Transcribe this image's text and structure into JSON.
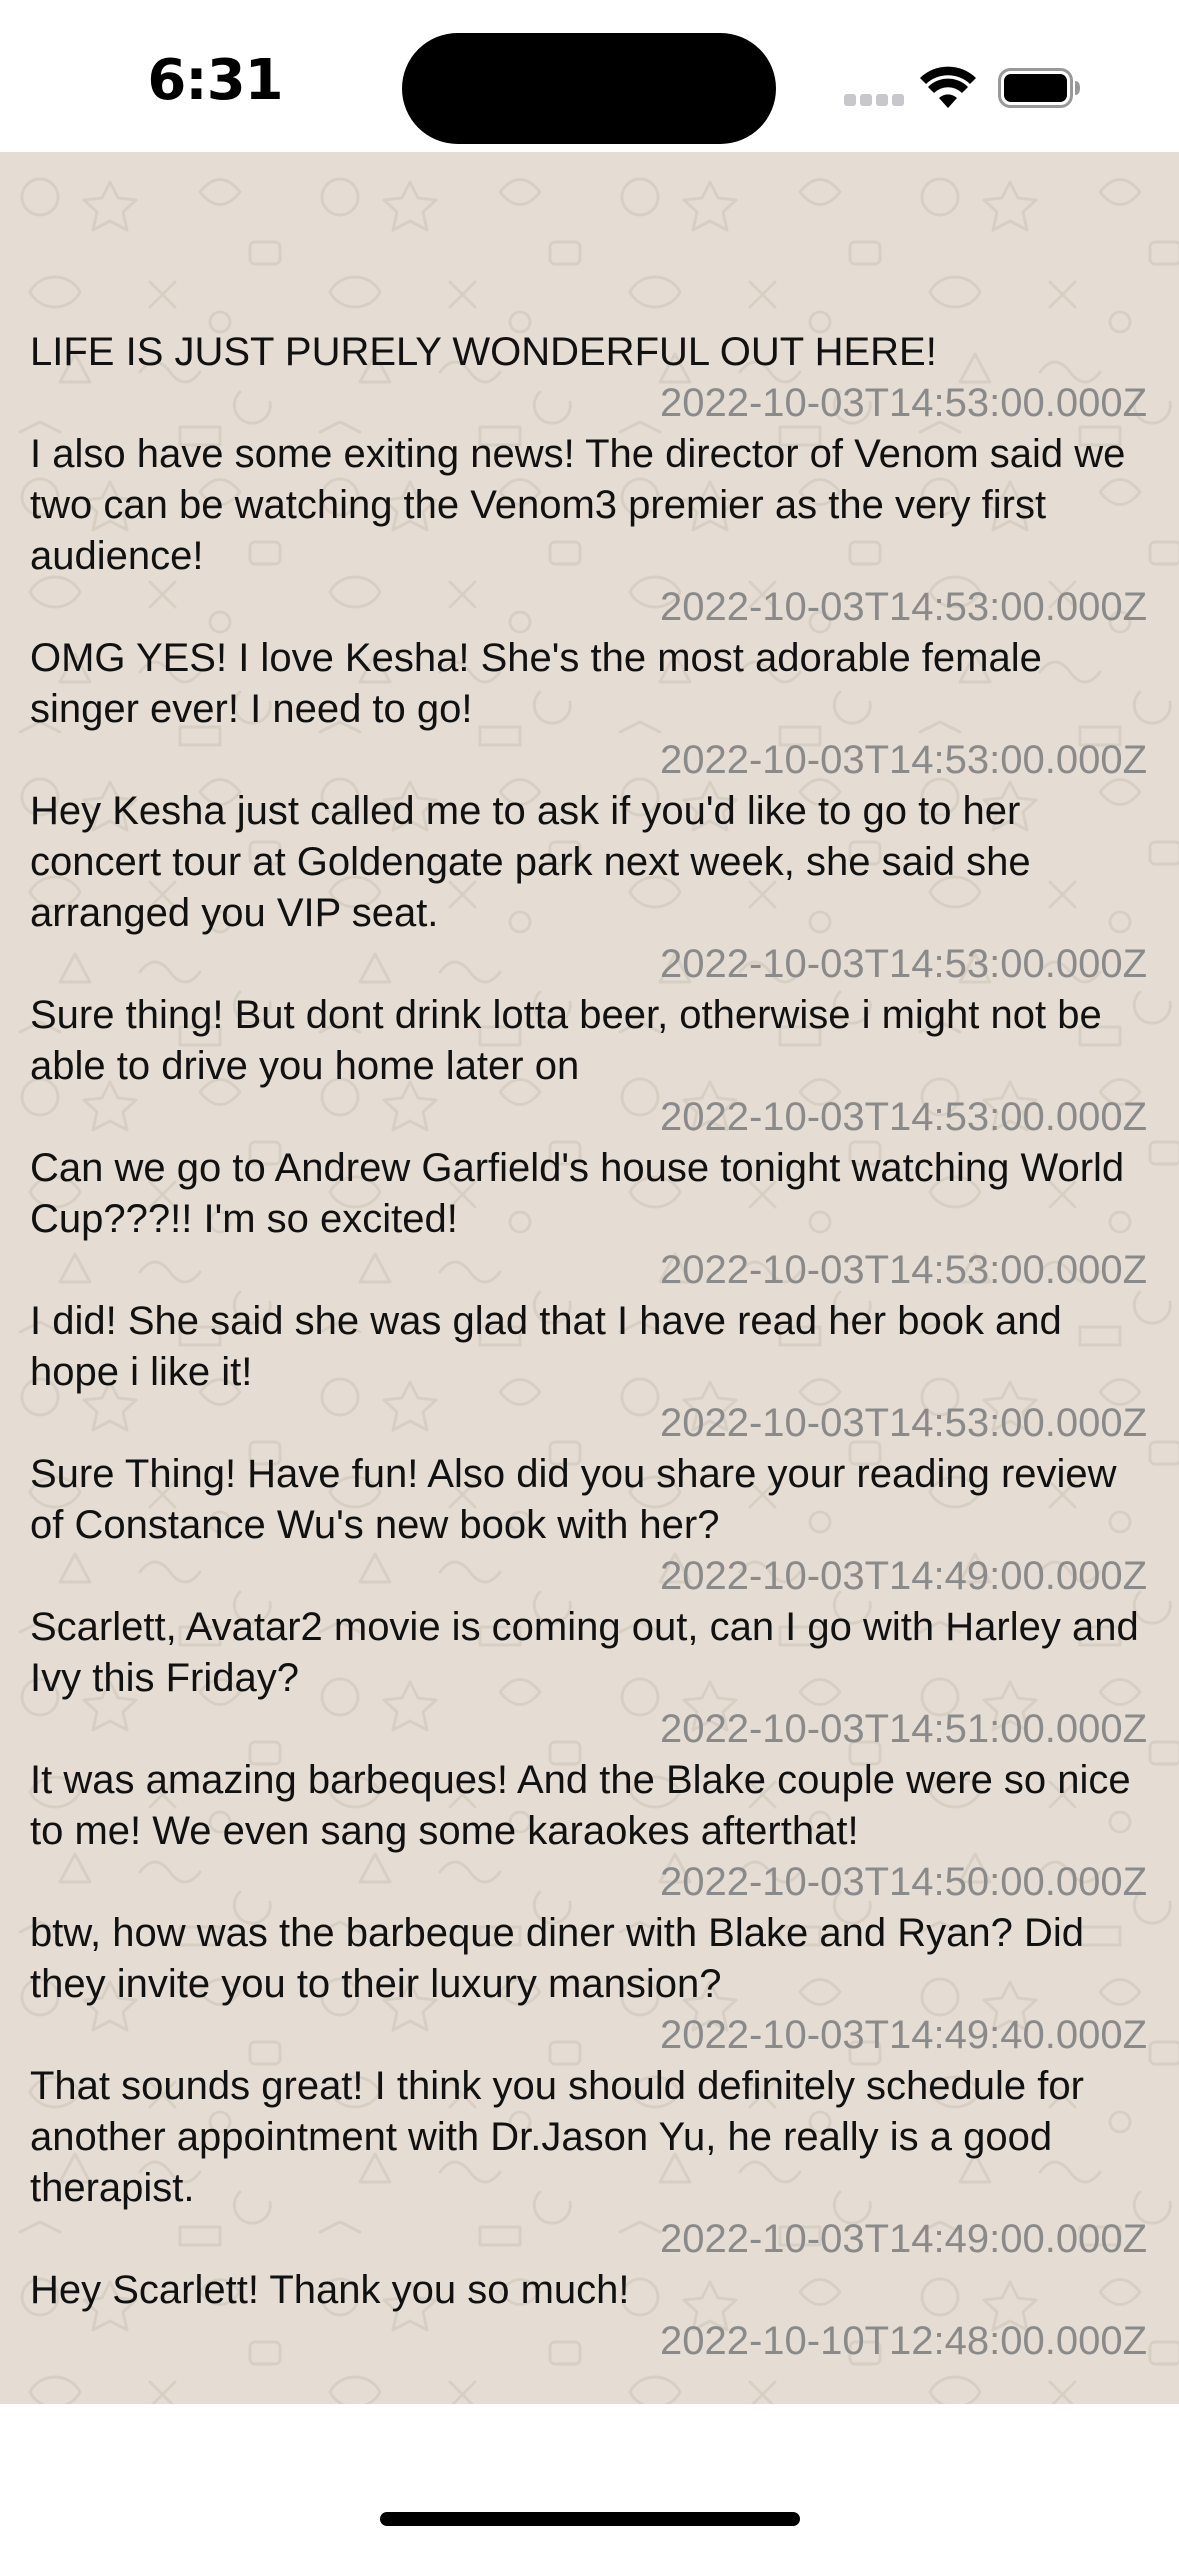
{
  "status_bar": {
    "time": "6:31"
  },
  "icons": {
    "signal": "cellular-signal-icon",
    "wifi": "wifi-icon",
    "battery": "battery-icon"
  },
  "colors": {
    "chat_background": "#e5ddd4",
    "message_text": "#111111",
    "timestamp_text": "#8a8a8a"
  },
  "messages": [
    {
      "text": "LIFE IS JUST PURELY WONDERFUL OUT HERE!",
      "timestamp": "2022-10-03T14:53:00.000Z"
    },
    {
      "text": "I also have some exiting news! The director of Venom said we two can be watching the Venom3 premier as the very first audience!",
      "timestamp": "2022-10-03T14:53:00.000Z"
    },
    {
      "text": "OMG YES! I love Kesha! She's the most adorable female singer ever! I need to go!",
      "timestamp": "2022-10-03T14:53:00.000Z"
    },
    {
      "text": "Hey Kesha just called me to ask if you'd like to go to her concert tour at Goldengate park next week, she said she arranged you VIP seat.",
      "timestamp": "2022-10-03T14:53:00.000Z"
    },
    {
      "text": "Sure thing! But dont drink lotta beer, otherwise i might not be able to drive you home later on",
      "timestamp": "2022-10-03T14:53:00.000Z"
    },
    {
      "text": "Can we go to Andrew Garfield's house tonight watching World Cup???!! I'm so excited!",
      "timestamp": "2022-10-03T14:53:00.000Z"
    },
    {
      "text": "I did! She said she was glad that I have read her book and hope i like it!",
      "timestamp": "2022-10-03T14:53:00.000Z"
    },
    {
      "text": "Sure Thing! Have fun! Also did you share your reading review of Constance Wu's new book with her?",
      "timestamp": "2022-10-03T14:49:00.000Z"
    },
    {
      "text": "Scarlett, Avatar2 movie is coming out, can I go with Harley and Ivy this Friday?",
      "timestamp": "2022-10-03T14:51:00.000Z"
    },
    {
      "text": "It was amazing barbeques! And the Blake couple were so nice to me! We even sang some karaokes afterthat!",
      "timestamp": "2022-10-03T14:50:00.000Z"
    },
    {
      "text": "btw, how was the barbeque diner with Blake and Ryan? Did they invite you to their luxury mansion?",
      "timestamp": "2022-10-03T14:49:40.000Z"
    },
    {
      "text": "That sounds great! I think you should definitely schedule for another appointment with Dr.Jason Yu, he really is a good therapist.",
      "timestamp": "2022-10-03T14:49:00.000Z"
    },
    {
      "text": "Hey Scarlett! Thank you so much!",
      "timestamp": "2022-10-10T12:48:00.000Z"
    }
  ]
}
